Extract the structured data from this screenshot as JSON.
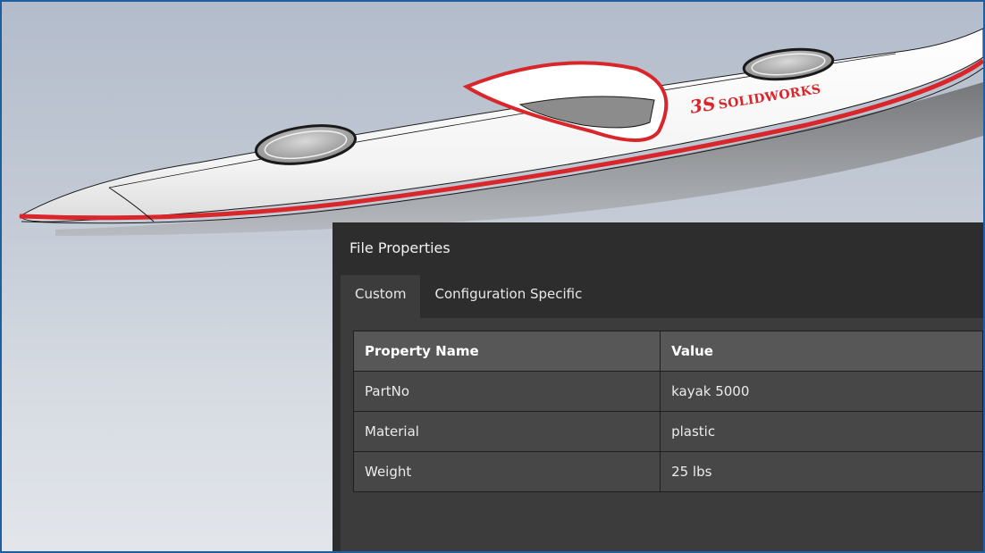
{
  "panel": {
    "title": "File Properties",
    "tabs": [
      {
        "label": "Custom",
        "active": true
      },
      {
        "label": "Configuration Specific",
        "active": false
      }
    ],
    "table": {
      "headers": [
        "Property Name",
        "Value"
      ],
      "rows": [
        {
          "name": "PartNo",
          "value": "kayak 5000"
        },
        {
          "name": "Material",
          "value": "plastic"
        },
        {
          "name": "Weight",
          "value": "25 lbs"
        }
      ]
    }
  },
  "model": {
    "logo_text": "SOLIDWORKS",
    "logo_mark": "3S",
    "hull_color": "#ffffff",
    "trim_color": "#d8262b"
  },
  "colors": {
    "frame_border": "#1f5fa0",
    "panel_bg": "#2d2d2d",
    "tab_bg": "#3c3c3c",
    "header_cell": "#575757",
    "data_cell": "#474747"
  }
}
